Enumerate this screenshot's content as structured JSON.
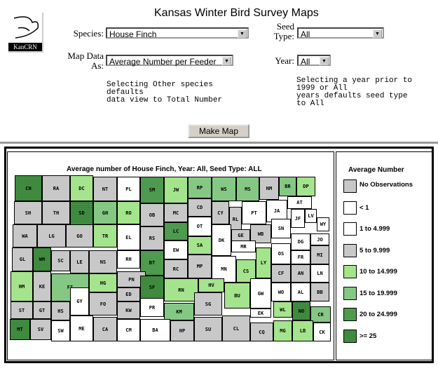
{
  "logo": {
    "text": "KanCRN"
  },
  "title": "Kansas Winter Bird Survey Maps",
  "form": {
    "species_label": "Species:",
    "species_value": "House Finch",
    "seed_label": "Seed Type:",
    "seed_value": "All",
    "mapdata_label": "Map Data As:",
    "mapdata_value": "Average Number per Feeder",
    "year_label": "Year:",
    "year_value": "All",
    "note_species": "Selecting Other species\ndefaults\ndata view to Total Number",
    "note_year": "Selecting a year prior to\n1999 or All\nyears defaults seed type\nto All",
    "make_map": "Make Map"
  },
  "map": {
    "title": "Average number of House Finch, Year: All, Seed Type: ALL",
    "colors": {
      "g": "#c8c8c8",
      "w": "#ffffff",
      "l1": "#a4e48c",
      "l2": "#84c884",
      "d1": "#4e9a4e",
      "d2": "#3f8a3f"
    },
    "counties": [
      {
        "name": "CN",
        "class": "d2"
      },
      {
        "name": "RA",
        "class": "g"
      },
      {
        "name": "DC",
        "class": "l1"
      },
      {
        "name": "NT",
        "class": "g"
      },
      {
        "name": "PL",
        "class": "w"
      },
      {
        "name": "SM",
        "class": "d1"
      },
      {
        "name": "JW",
        "class": "l1"
      },
      {
        "name": "RP",
        "class": "l2"
      },
      {
        "name": "WS",
        "class": "l2"
      },
      {
        "name": "MS",
        "class": "l2"
      },
      {
        "name": "NM",
        "class": "g"
      },
      {
        "name": "BR",
        "class": "l2"
      },
      {
        "name": "DP",
        "class": "l1"
      },
      {
        "name": "SH",
        "class": "g"
      },
      {
        "name": "TH",
        "class": "g"
      },
      {
        "name": "SD",
        "class": "d2"
      },
      {
        "name": "GH",
        "class": "l2"
      },
      {
        "name": "RO",
        "class": "l1"
      },
      {
        "name": "OB",
        "class": "g"
      },
      {
        "name": "MC",
        "class": "g"
      },
      {
        "name": "CD",
        "class": "g"
      },
      {
        "name": "CY",
        "class": "g"
      },
      {
        "name": "RL",
        "class": "g"
      },
      {
        "name": "PT",
        "class": "w"
      },
      {
        "name": "JA",
        "class": "w"
      },
      {
        "name": "AT",
        "class": "w"
      },
      {
        "name": "WA",
        "class": "g"
      },
      {
        "name": "LG",
        "class": "g"
      },
      {
        "name": "GO",
        "class": "g"
      },
      {
        "name": "TR",
        "class": "l1"
      },
      {
        "name": "EL",
        "class": "w"
      },
      {
        "name": "RS",
        "class": "g"
      },
      {
        "name": "LC",
        "class": "d1"
      },
      {
        "name": "OT",
        "class": "w"
      },
      {
        "name": "DK",
        "class": "w"
      },
      {
        "name": "GE",
        "class": "g"
      },
      {
        "name": "WB",
        "class": "g"
      },
      {
        "name": "SN",
        "class": "w"
      },
      {
        "name": "JF",
        "class": "w"
      },
      {
        "name": "LV",
        "class": "w"
      },
      {
        "name": "WY",
        "class": "w"
      },
      {
        "name": "GL",
        "class": "g"
      },
      {
        "name": "WH",
        "class": "d2"
      },
      {
        "name": "SC",
        "class": "g"
      },
      {
        "name": "LE",
        "class": "g"
      },
      {
        "name": "NS",
        "class": "g"
      },
      {
        "name": "RH",
        "class": "w"
      },
      {
        "name": "BT",
        "class": "d1"
      },
      {
        "name": "EW",
        "class": "w"
      },
      {
        "name": "RC",
        "class": "g"
      },
      {
        "name": "SA",
        "class": "l1"
      },
      {
        "name": "MP",
        "class": "g"
      },
      {
        "name": "MR",
        "class": "w"
      },
      {
        "name": "LY",
        "class": "l1"
      },
      {
        "name": "MN",
        "class": "w"
      },
      {
        "name": "CS",
        "class": "l1"
      },
      {
        "name": "OS",
        "class": "w"
      },
      {
        "name": "FR",
        "class": "w"
      },
      {
        "name": "DG",
        "class": "w"
      },
      {
        "name": "JO",
        "class": "w"
      },
      {
        "name": "MI",
        "class": "g"
      },
      {
        "name": "HM",
        "class": "l1"
      },
      {
        "name": "KE",
        "class": "g"
      },
      {
        "name": "FI",
        "class": "l2"
      },
      {
        "name": "HG",
        "class": "l1"
      },
      {
        "name": "PN",
        "class": "g"
      },
      {
        "name": "SF",
        "class": "d2"
      },
      {
        "name": "RN",
        "class": "l1"
      },
      {
        "name": "HV",
        "class": "l1"
      },
      {
        "name": "BU",
        "class": "l1"
      },
      {
        "name": "CF",
        "class": "g"
      },
      {
        "name": "AN",
        "class": "g"
      },
      {
        "name": "LN",
        "class": "w"
      },
      {
        "name": "ED",
        "class": "g"
      },
      {
        "name": "GY",
        "class": "w"
      },
      {
        "name": "ST",
        "class": "g"
      },
      {
        "name": "GT",
        "class": "g"
      },
      {
        "name": "HS",
        "class": "g"
      },
      {
        "name": "FO",
        "class": "g"
      },
      {
        "name": "KW",
        "class": "g"
      },
      {
        "name": "PR",
        "class": "w"
      },
      {
        "name": "KM",
        "class": "l2"
      },
      {
        "name": "SG",
        "class": "g"
      },
      {
        "name": "GW",
        "class": "w"
      },
      {
        "name": "WO",
        "class": "w"
      },
      {
        "name": "AL",
        "class": "w"
      },
      {
        "name": "BB",
        "class": "g"
      },
      {
        "name": "MT",
        "class": "d2"
      },
      {
        "name": "SV",
        "class": "g"
      },
      {
        "name": "SW",
        "class": "w"
      },
      {
        "name": "ME",
        "class": "w"
      },
      {
        "name": "CA",
        "class": "g"
      },
      {
        "name": "CM",
        "class": "w"
      },
      {
        "name": "BA",
        "class": "w"
      },
      {
        "name": "HP",
        "class": "g"
      },
      {
        "name": "SU",
        "class": "g"
      },
      {
        "name": "CL",
        "class": "g"
      },
      {
        "name": "CQ",
        "class": "g"
      },
      {
        "name": "EK",
        "class": "w"
      },
      {
        "name": "WL",
        "class": "l1"
      },
      {
        "name": "NO",
        "class": "d2"
      },
      {
        "name": "CR",
        "class": "l2"
      },
      {
        "name": "MG",
        "class": "l1"
      },
      {
        "name": "LB",
        "class": "l1"
      },
      {
        "name": "CK",
        "class": "w"
      }
    ]
  },
  "legend": {
    "title": "Average Number",
    "items": [
      {
        "label": "No Observations",
        "class": "g"
      },
      {
        "label": "< 1",
        "class": "w"
      },
      {
        "label": "1 to 4.999",
        "class": "w"
      },
      {
        "label": "5 to 9.999",
        "class": "g"
      },
      {
        "label": "10 to 14.999",
        "class": "l1"
      },
      {
        "label": "15 to 19.999",
        "class": "l2"
      },
      {
        "label": "20 to 24.999",
        "class": "d1"
      },
      {
        "label": ">= 25",
        "class": "d2"
      }
    ]
  }
}
